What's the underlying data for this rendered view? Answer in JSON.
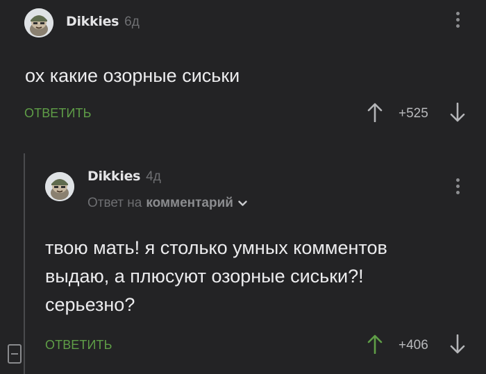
{
  "comment_1": {
    "username": "Dikkies",
    "time": "6д",
    "text": "ох какие озорные сиськи",
    "reply_label": "ОТВЕТИТЬ",
    "rating": "+525"
  },
  "comment_2": {
    "username": "Dikkies",
    "time": "4д",
    "reply_to_prefix": "Ответ на",
    "reply_to_link": "комментарий",
    "text_lines": [
      "твою мать! я столько умных комментов",
      "выдаю, а плюсуют озорные сиськи?!",
      "серьезно?"
    ],
    "reply_label": "ОТВЕТИТЬ",
    "rating": "+406"
  },
  "icons": {
    "menu": "kebab-icon",
    "upvote": "arrow-up-icon",
    "downvote": "arrow-down-icon",
    "collapse": "minus-box-icon",
    "expand": "chevron-down-icon"
  },
  "colors": {
    "background": "#232325",
    "accent_green": "#5f9e47",
    "text": "#ececee",
    "muted": "#6e6f72"
  }
}
